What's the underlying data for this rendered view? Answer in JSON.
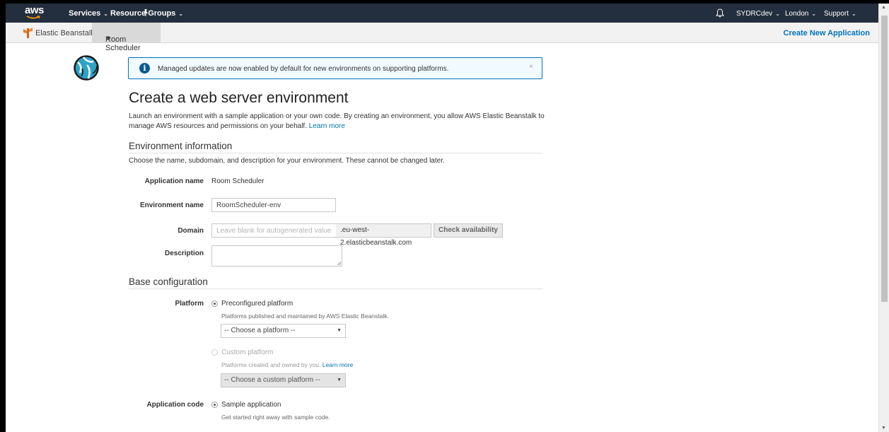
{
  "topnav": {
    "logo_text": "aws",
    "services_label": "Services",
    "resource_groups_label": "Resource Groups",
    "account_label": "SYDRCdev",
    "region_label": "London",
    "support_label": "Support"
  },
  "subnav": {
    "eb_label": "Elastic Beanstalk",
    "app_label": "Room Scheduler",
    "create_label": "Create New Application"
  },
  "banner": {
    "text": "Managed updates are now enabled by default for new environments on supporting platforms.",
    "close": "×"
  },
  "page": {
    "title": "Create a web server environment",
    "intro": "Launch an environment with a sample application or your own code. By creating an environment, you allow AWS Elastic Beanstalk to manage AWS resources and permissions on your behalf.",
    "learn_more": "Learn more"
  },
  "env_info": {
    "title": "Environment information",
    "description": "Choose the name, subdomain, and description for your environment. These cannot be changed later.",
    "app_name_label": "Application name",
    "app_name_value": "Room Scheduler",
    "env_name_label": "Environment name",
    "env_name_value": "RoomScheduler-env",
    "domain_label": "Domain",
    "domain_placeholder": "Leave blank for autogenerated value",
    "domain_suffix": ".eu-west-2.elasticbeanstalk.com",
    "check_label": "Check availability",
    "description_label": "Description"
  },
  "base_config": {
    "title": "Base configuration",
    "platform_label": "Platform",
    "preconfigured_label": "Preconfigured platform",
    "preconfigured_hint": "Platforms published and maintained by AWS Elastic Beanstalk.",
    "platform_select": "-- Choose a platform --",
    "custom_label": "Custom platform",
    "custom_hint": "Platforms created and owned by you.",
    "custom_learn_more": "Learn more",
    "custom_select": "-- Choose a custom platform --",
    "app_code_label": "Application code",
    "sample_label": "Sample application",
    "sample_hint": "Get started right away with sample code."
  }
}
